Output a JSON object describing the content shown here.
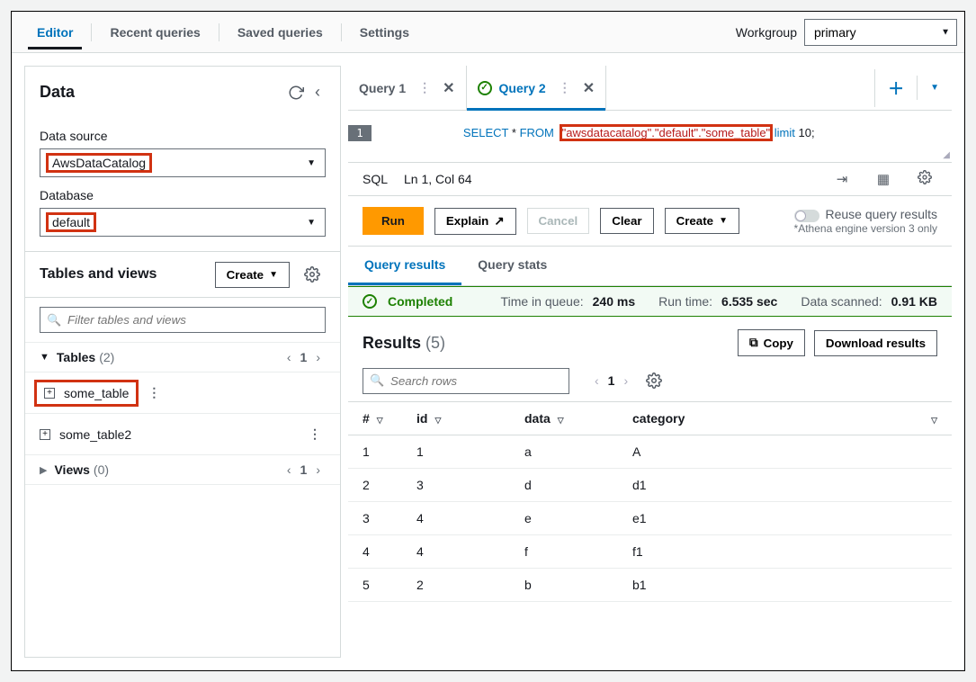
{
  "topnav": {
    "tabs": [
      "Editor",
      "Recent queries",
      "Saved queries",
      "Settings"
    ],
    "workgroup_label": "Workgroup",
    "workgroup_value": "primary"
  },
  "sidebar": {
    "title": "Data",
    "data_source_label": "Data source",
    "data_source_value": "AwsDataCatalog",
    "database_label": "Database",
    "database_value": "default",
    "tables_views_title": "Tables and views",
    "create_label": "Create",
    "filter_placeholder": "Filter tables and views",
    "tables_label": "Tables",
    "tables_count": "(2)",
    "tables_page": "1",
    "tables": [
      "some_table",
      "some_table2"
    ],
    "views_label": "Views",
    "views_count": "(0)",
    "views_page": "1"
  },
  "query_tabs": {
    "tab1": "Query 1",
    "tab2": "Query 2"
  },
  "editor": {
    "line_no": "1",
    "kw1": "SELECT",
    "star": " * ",
    "kw2": "FROM",
    "str": "\"awsdatacatalog\".\"default\".\"some_table\"",
    "limit": " limit ",
    "n10": "10",
    "semi": ";"
  },
  "statusbar": {
    "lang": "SQL",
    "pos": "Ln 1, Col 64"
  },
  "actions": {
    "run": "Run",
    "explain": "Explain",
    "cancel": "Cancel",
    "clear": "Clear",
    "create": "Create",
    "reuse_label": "Reuse query results",
    "engine_note": "*Athena engine version 3 only"
  },
  "result_tabs": {
    "results": "Query results",
    "stats": "Query stats"
  },
  "status": {
    "state": "Completed",
    "queue_l": "Time in queue:",
    "queue_v": "240 ms",
    "run_l": "Run time:",
    "run_v": "6.535 sec",
    "scan_l": "Data scanned:",
    "scan_v": "0.91 KB"
  },
  "results": {
    "title": "Results",
    "count": "(5)",
    "copy": "Copy",
    "download": "Download results",
    "search_placeholder": "Search rows",
    "page": "1",
    "headers": {
      "num": "#",
      "id": "id",
      "data": "data",
      "category": "category"
    },
    "rows": [
      {
        "n": "1",
        "id": "1",
        "data": "a",
        "cat": "A"
      },
      {
        "n": "2",
        "id": "3",
        "data": "d",
        "cat": "d1"
      },
      {
        "n": "3",
        "id": "4",
        "data": "e",
        "cat": "e1"
      },
      {
        "n": "4",
        "id": "4",
        "data": "f",
        "cat": "f1"
      },
      {
        "n": "5",
        "id": "2",
        "data": "b",
        "cat": "b1"
      }
    ]
  }
}
